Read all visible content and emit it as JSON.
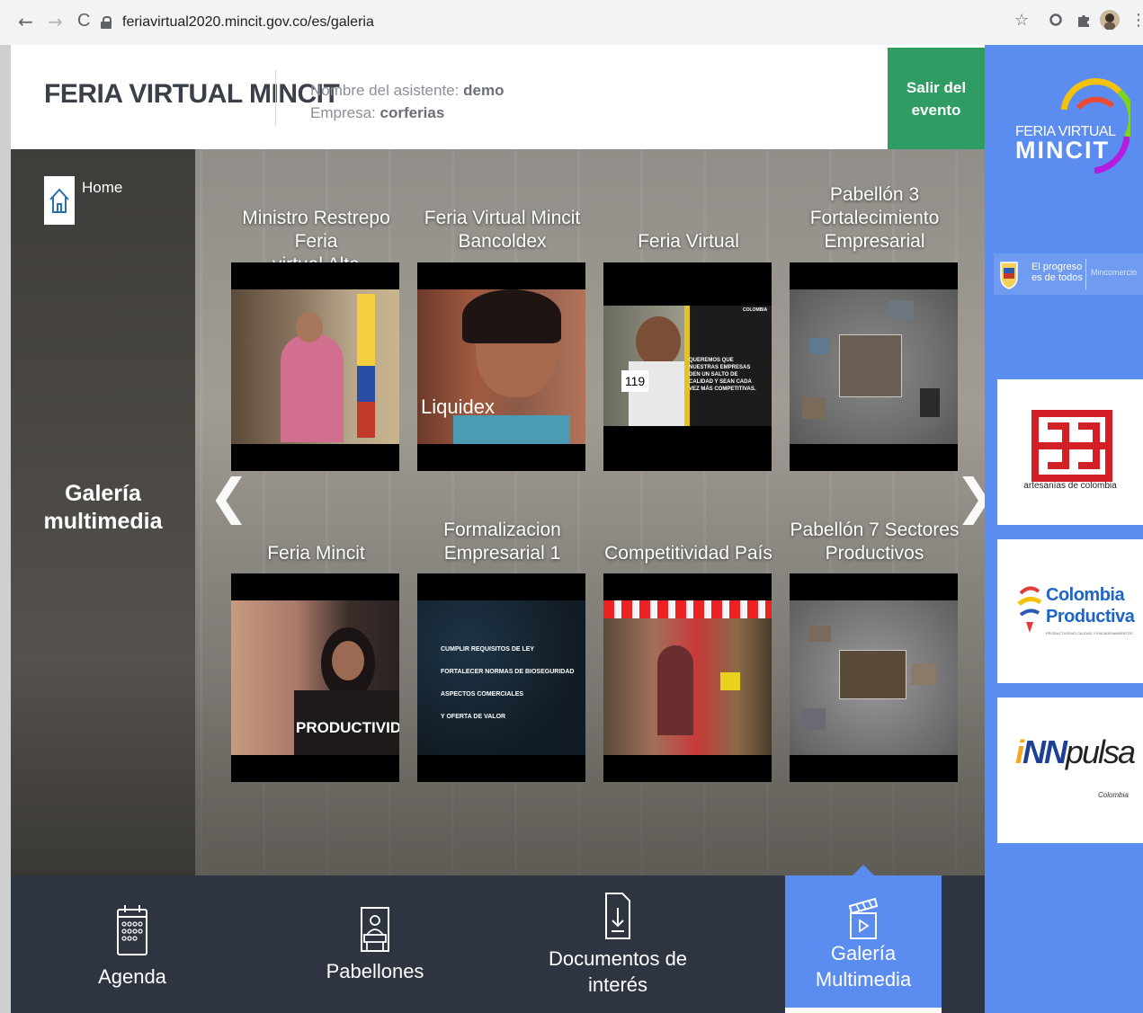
{
  "browser": {
    "url": "feriavirtual2020.mincit.gov.co/es/galeria",
    "back": "←",
    "forward": "→",
    "reload": "C",
    "star": "☆",
    "menu": "⋮"
  },
  "header": {
    "brand": "FERIA VIRTUAL MINCIT",
    "attendee_label": "Nombre del asistente:",
    "attendee_name": "demo",
    "company_label": "Empresa:",
    "company_name": "corferias",
    "logout_line1": "Salir del",
    "logout_line2": "evento"
  },
  "main": {
    "home_label": "Home",
    "section_title_line1": "Galería",
    "section_title_line2": "multimedia",
    "prev_arrow": "❮",
    "next_arrow": "❯",
    "videos": [
      {
        "title_line1": "Ministro Restrepo Feria",
        "title_line2": "virtual Alta",
        "caption": ""
      },
      {
        "title_line1": "Feria Virtual Mincit",
        "title_line2": "Bancoldex",
        "caption": "Liquidex"
      },
      {
        "title_line1": "",
        "title_line2": "Feria Virtual",
        "caption": "QUEREMOS QUE NUESTRAS EMPRESAS DEN UN SALTO DE CALIDAD Y SEAN CADA VEZ MÁS COMPETITIVAS.",
        "badge": "119",
        "brand": "COLOMBIA"
      },
      {
        "title_line1": "Pabellón 3",
        "title_line2": "Fortalecimiento",
        "title_line3": "Empresarial",
        "caption": ""
      },
      {
        "title_line1": "",
        "title_line2": "Feria Mincit",
        "caption": "PRODUCTIVIDAD"
      },
      {
        "title_line1": "Formalizacion",
        "title_line2": "Empresarial 1",
        "caption_lines": [
          "CUMPLIR REQUISITOS DE LEY",
          "FORTALECER NORMAS DE BIOSEGURIDAD",
          "ASPECTOS COMERCIALES",
          "Y OFERTA DE VALOR"
        ]
      },
      {
        "title_line1": "",
        "title_line2": "Competitividad País",
        "caption": ""
      },
      {
        "title_line1": "Pabellón 7 Sectores",
        "title_line2": "Productivos",
        "caption": ""
      }
    ]
  },
  "bottom_nav": [
    {
      "label_line1": "Agenda",
      "label_line2": "",
      "icon": "calendar-icon",
      "active": false
    },
    {
      "label_line1": "Pabellones",
      "label_line2": "",
      "icon": "booth-icon",
      "active": false
    },
    {
      "label_line1": "Documentos de",
      "label_line2": "interés",
      "icon": "document-download-icon",
      "active": false
    },
    {
      "label_line1": "Galería",
      "label_line2": "Multimedia",
      "icon": "clapperboard-icon",
      "active": true
    }
  ],
  "sidebar": {
    "logo_line1": "FERIA VIRTUAL",
    "logo_line2": "MINCIT",
    "gov_line1": "El progreso",
    "gov_line2": "es de todos",
    "gov_ministry": "Mincomercio",
    "sponsors": [
      {
        "name": "artesanías de colombia"
      },
      {
        "name_line1": "Colombia",
        "name_line2": "Productiva",
        "tagline": "PRODUCTIVIDAD CALIDAD Y ENCADENAMIENTOS"
      },
      {
        "name": "iNNpulsa",
        "sub": "Colombia"
      }
    ]
  },
  "colors": {
    "accent_blue": "#5b8cef",
    "logout_green": "#2e9c63",
    "nav_dark": "#2e3440",
    "artesanias_red": "#d51f26"
  }
}
